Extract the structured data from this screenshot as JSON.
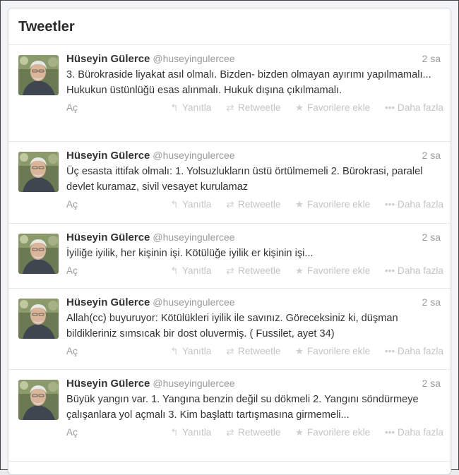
{
  "header": {
    "title": "Tweetler"
  },
  "actions": {
    "open": "Aç",
    "reply": "Yanıtla",
    "retweet": "Retweetle",
    "favorite": "Favorilere ekle",
    "more": "Daha fazla",
    "reply_icon": "reply-arrow-icon",
    "retweet_icon": "retweet-icon",
    "favorite_icon": "star-icon",
    "more_icon": "more-dots-icon"
  },
  "tweets": [
    {
      "name": "Hüseyin Gülerce",
      "handle": "@huseyingulercee",
      "time": "2 sa",
      "text": "3. Bürokraside liyakat asıl olmalı. Bizden- bizden olmayan ayırımı yapılmamalı... Hukukun üstünlüğü esas alınmalı. Hukuk dışına çıkılmamalı."
    },
    {
      "name": "Hüseyin Gülerce",
      "handle": "@huseyingulercee",
      "time": "2 sa",
      "text": "Üç esasta ittifak olmalı: 1. Yolsuzlukların üstü örtülmemeli 2. Bürokrasi, paralel devlet kuramaz, sivil vesayet kurulamaz"
    },
    {
      "name": "Hüseyin Gülerce",
      "handle": "@huseyingulercee",
      "time": "2 sa",
      "text": "İyiliğe iyilik, her kişinin işi. Kötülüğe iyilik er kişinin işi..."
    },
    {
      "name": "Hüseyin Gülerce",
      "handle": "@huseyingulercee",
      "time": "2 sa",
      "text": "Allah(cc) buyuruyor: Kötülükleri iyilik ile savınız. Göreceksiniz ki, düşman bildikleriniz sımsıcak bir dost oluvermiş. ( Fussilet, ayet 34)"
    },
    {
      "name": "Hüseyin Gülerce",
      "handle": "@huseyingulercee",
      "time": "2 sa",
      "text": "Büyük yangın var. 1. Yangına benzin değil su dökmeli 2. Yangını söndürmeye çalışanlara yol açmalı 3. Kim başlattı tartışmasına girmemeli..."
    }
  ]
}
